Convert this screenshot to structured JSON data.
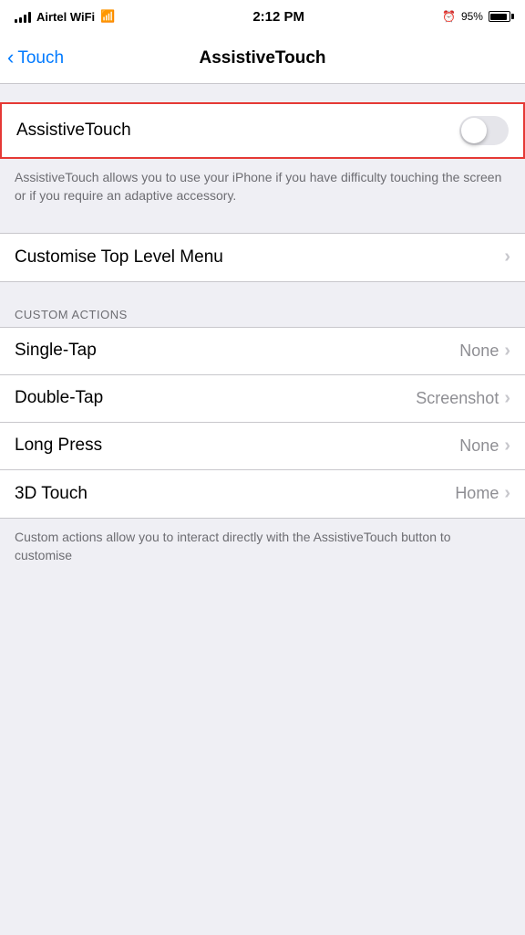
{
  "statusBar": {
    "carrier": "Airtel WiFi",
    "time": "2:12 PM",
    "battery": "95%"
  },
  "navBar": {
    "backLabel": "Touch",
    "title": "AssistiveTouch"
  },
  "assistiveTouch": {
    "rowLabel": "AssistiveTouch",
    "enabled": false,
    "description": "AssistiveTouch allows you to use your iPhone if you have difficulty touching the screen or if you require an adaptive accessory."
  },
  "customiseMenu": {
    "label": "Customise Top Level Menu"
  },
  "customActions": {
    "sectionHeader": "CUSTOM ACTIONS",
    "rows": [
      {
        "label": "Single-Tap",
        "value": "None"
      },
      {
        "label": "Double-Tap",
        "value": "Screenshot"
      },
      {
        "label": "Long Press",
        "value": "None"
      },
      {
        "label": "3D Touch",
        "value": "Home"
      }
    ],
    "footer": "Custom actions allow you to interact directly with the AssistiveTouch button to customise"
  }
}
